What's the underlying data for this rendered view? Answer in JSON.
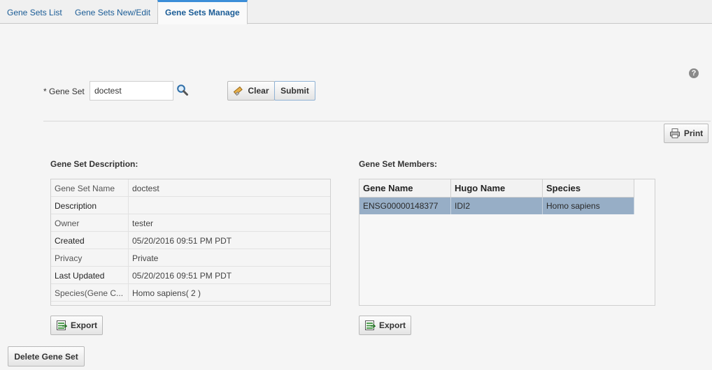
{
  "tabs": [
    {
      "label": "Gene Sets List",
      "active": false
    },
    {
      "label": "Gene Sets New/Edit",
      "active": false
    },
    {
      "label": "Gene Sets Manage",
      "active": true
    }
  ],
  "help_icon": {
    "glyph": "?"
  },
  "form": {
    "gene_set_label": "* Gene Set",
    "gene_set_value": "doctest",
    "clear_label": "Clear",
    "submit_label": "Submit"
  },
  "print_label": "Print",
  "description": {
    "title": "Gene Set Description:",
    "rows": [
      {
        "label": "Gene Set Name",
        "value": "doctest"
      },
      {
        "label": "Description",
        "value": ""
      },
      {
        "label": "Owner",
        "value": "tester"
      },
      {
        "label": "Created",
        "value": "05/20/2016 09:51 PM PDT"
      },
      {
        "label": "Privacy",
        "value": "Private"
      },
      {
        "label": "Last Updated",
        "value": "05/20/2016 09:51 PM PDT"
      },
      {
        "label": "Species(Gene C...",
        "value": "Homo sapiens( 2 )"
      }
    ],
    "export_label": "Export"
  },
  "members": {
    "title": "Gene Set Members:",
    "columns": [
      "Gene Name",
      "Hugo Name",
      "Species"
    ],
    "rows": [
      [
        "ENSG00000148377",
        "IDI2",
        "Homo sapiens"
      ]
    ],
    "export_label": "Export"
  },
  "delete_label": "Delete Gene Set",
  "colors": {
    "accent": "#3c8ed8",
    "link": "#1a5c96",
    "selected_row": "#97aec6"
  }
}
